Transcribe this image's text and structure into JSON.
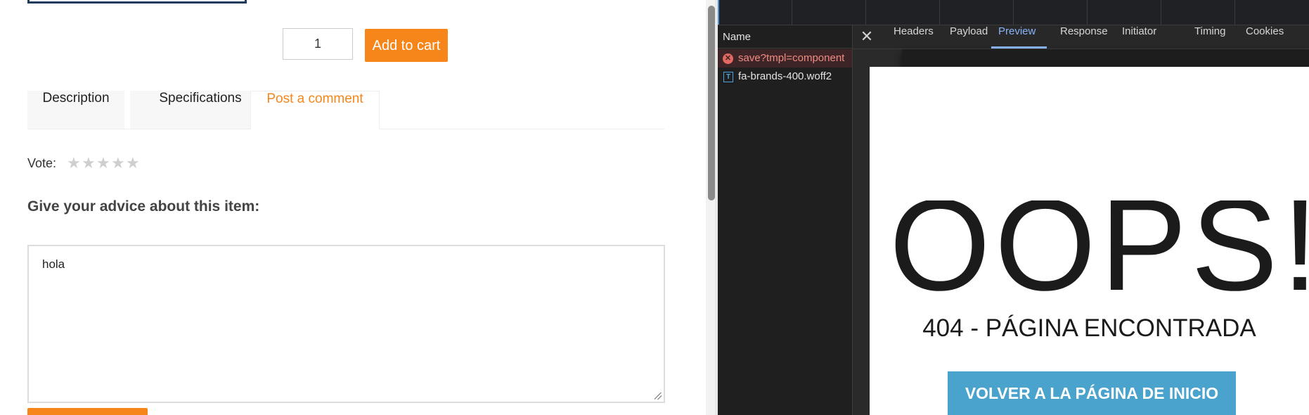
{
  "product": {
    "quantity": "1",
    "add_to_cart": "Add to cart",
    "tabs": [
      "Description",
      "Specifications",
      "Post a comment"
    ],
    "vote_label": "Vote:",
    "stars_count": 5,
    "advice_heading": "Give your advice about this item:",
    "comment_value": "hola",
    "accent_color": "#f7861a"
  },
  "devtools": {
    "name_header": "Name",
    "requests": [
      {
        "name": "save?tmpl=component",
        "status": "error"
      },
      {
        "name": "fa-brands-400.woff2",
        "status": "ok"
      }
    ],
    "tabs": [
      "Headers",
      "Payload",
      "Preview",
      "Response",
      "Initiator",
      "Timing",
      "Cookies"
    ],
    "active_tab": "Preview",
    "close_icon": "close-icon"
  },
  "preview": {
    "headline": "OOPS!",
    "subtitle": "404 - PÁGINA ENCONTRADA",
    "home_button": "VOLVER A LA PÁGINA DE INICIO"
  }
}
